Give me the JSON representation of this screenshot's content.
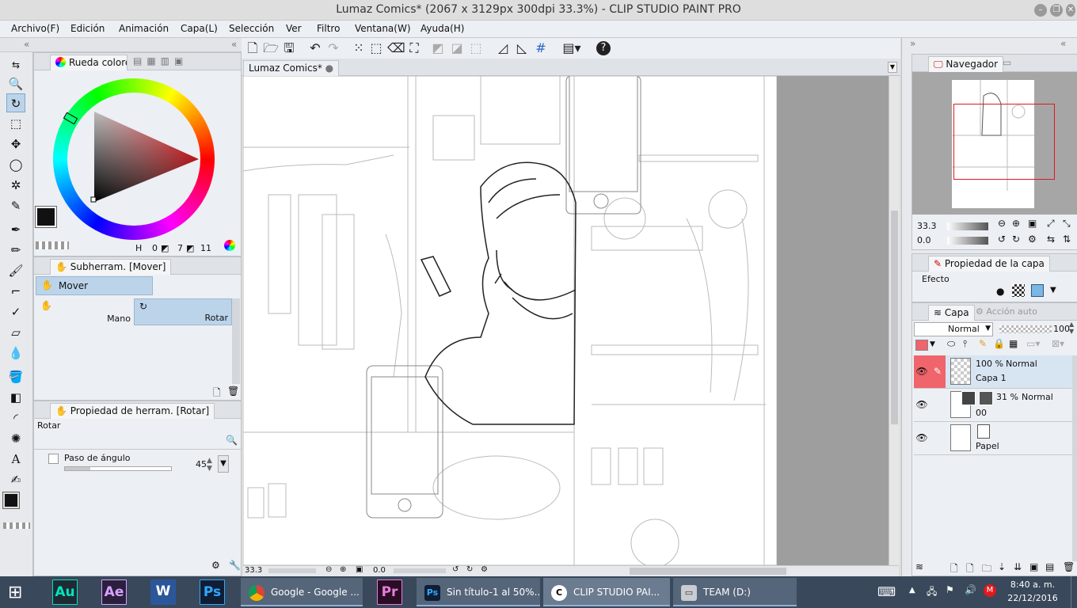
{
  "window": {
    "title": "Lumaz Comics* (2067 x 3129px 300dpi 33.3%) - CLIP STUDIO PAINT PRO"
  },
  "menu": [
    "Archivo(F)",
    "Edición",
    "Animación",
    "Capa(L)",
    "Selección",
    "Ver",
    "Filtro",
    "Ventana(W)",
    "Ayuda(H)"
  ],
  "document": {
    "tab_label": "Lumaz Comics*"
  },
  "color_panel": {
    "tab_label": "Rueda colore",
    "h_value": "0",
    "s_value": "7",
    "v_value": "11"
  },
  "subtool_panel": {
    "tab_label": "Subherram. [Mover]",
    "group_label": "Mover",
    "items": [
      "Mano",
      "Rotar"
    ]
  },
  "tool_property": {
    "tab_label": "Propiedad de herram. [Rotar]",
    "tool_name": "Rotar",
    "angle_step_label": "Paso de ángulo",
    "angle_step_value": "45"
  },
  "navigator": {
    "tab_label": "Navegador",
    "zoom": "33.3",
    "rotation": "0.0"
  },
  "status": {
    "zoom": "33.3",
    "rotation": "0.0"
  },
  "layer_property": {
    "tab_label": "Propiedad de la capa",
    "effect_label": "Efecto"
  },
  "layers_panel": {
    "tab_label": "Capa",
    "tab2_label": "Acción auto",
    "blend_mode": "Normal",
    "opacity": "100",
    "layers": [
      {
        "opacity": "100 %",
        "mode": "Normal",
        "name": "Capa 1"
      },
      {
        "opacity": "31 %",
        "mode": "Normal",
        "name": "00"
      },
      {
        "opacity": "",
        "mode": "",
        "name": "Papel"
      }
    ]
  },
  "taskbar": {
    "apps": [
      {
        "icon": "Au",
        "color": "#00e4bb",
        "bg": "#1f2a35"
      },
      {
        "icon": "Ae",
        "color": "#d8a1ff",
        "bg": "#2a1f3d"
      },
      {
        "icon": "W",
        "color": "#ffffff",
        "bg": "#2b579a"
      },
      {
        "icon": "Ps",
        "color": "#31a8ff",
        "bg": "#0f1e35"
      }
    ],
    "windows": [
      "Google - Google ...",
      "Sin título-1 al 50%...",
      "CLIP STUDIO PAI...",
      "TEAM (D:)"
    ],
    "time": "8:40 a. m.",
    "date": "22/12/2016"
  },
  "colors": {
    "accent": "#bcd4ea",
    "layer_highlight": "#f0646b",
    "taskbar": "#39485a",
    "nav_frame": "#e0191e"
  }
}
